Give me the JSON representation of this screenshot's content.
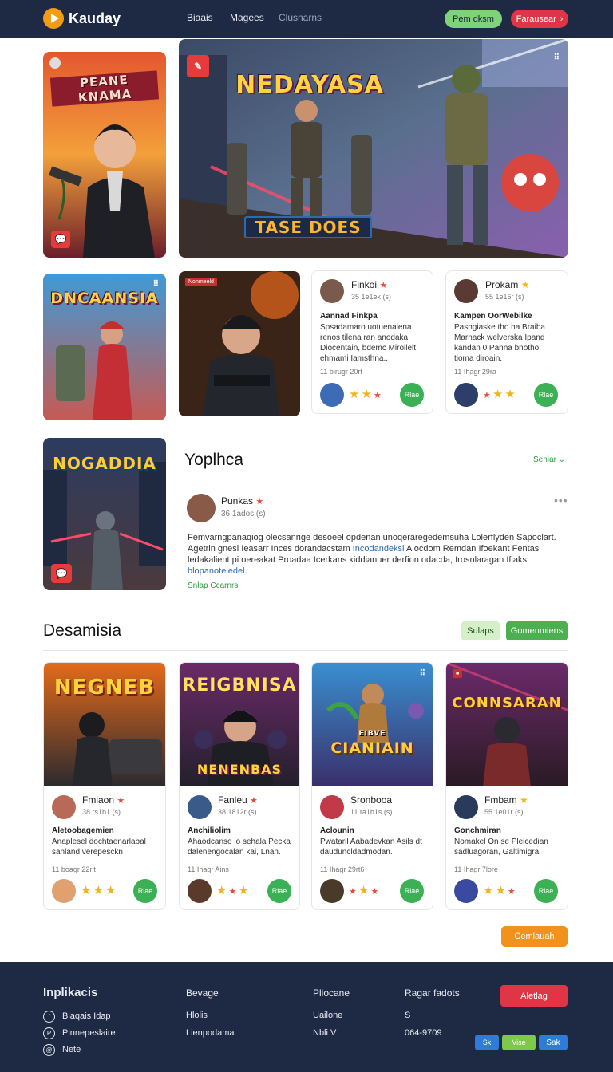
{
  "nav": {
    "brand": "Kauday",
    "links": [
      "Biaais",
      "Magees",
      "Clusnarns"
    ],
    "btn_green": "Pem dksm",
    "btn_red": "Farausear"
  },
  "hero": {
    "left_title": "PEANE KNAMA",
    "main_title": "NEDAYASA",
    "main_subtitle": "TASE DOES"
  },
  "row2": {
    "art1_title": "DNCAANSIA",
    "art2_tag": "Nonmeeld",
    "posts": [
      {
        "user": "Finkoi",
        "meta": "35 1e1ek (s)",
        "title": "Aannad Finkpa",
        "body": "Spsadamaro uotuenalena renos tilena ran anodaka Diocentain, bdemc Miroilelt, ehmami Iamsthna..",
        "date": "11 birugr 20rt",
        "btn": "Rlae"
      },
      {
        "user": "Prokam",
        "meta": "55 1e16r (s)",
        "title": "Kampen OorWebilke",
        "body": "Pashgiaske tho ha Braiba Marnack welverska Ipand kandan 0 Panna bnotho tioma diroain.",
        "date": "11 Ihagr 29ra",
        "btn": "Rlae"
      }
    ]
  },
  "feature": {
    "art_title": "NOGADDIA",
    "section_title": "Yoplhca",
    "see_all": "Seniar",
    "user": "Punkas",
    "meta": "36 1ados (s)",
    "body1_plain": "Femvarngpanaqiog olecsanrige desoeel opdenan unoqeraregedemsuha Lolerflyden Sapoclart. Agetrin gnesi Ieasarr Inces dorandacstam ",
    "body1_link": "Incodandeksi",
    "body2_plain": "Alocdom Remdan Ifoekant Fentas ledakalient pi oereakat Proadaa Icerkans kiddianuer derfion odacda, Irosnlaragan Ifiaks ",
    "body2_link": "blopanoteledel.",
    "more": "Snlap Ccarnrs"
  },
  "desamisia": {
    "title": "Desamisia",
    "pill1": "Sulaps",
    "pill2": "Gomenmiens",
    "cards": [
      {
        "art": "NEGNEB",
        "user": "Fmiaon",
        "meta": "38 rs1b1 (s)",
        "title": "Aletoobagemien",
        "body": "Anaplesel dochtaenarlabal sanland verepesckn",
        "date": "11 boagr 22rit",
        "btn": "Rlae"
      },
      {
        "art": "REIGBNISA",
        "art_sub": "NENENBAS",
        "user": "Fanleu",
        "meta": "38 1812r (s)",
        "title": "Anchiliolim",
        "body": "Ahaodcanso lo sehala Pecka dalenengocalan kai, Lnan.",
        "date": "11 Ihagr Ains",
        "btn": "Rlae"
      },
      {
        "art": "CIANIAIN",
        "art_sub": "EIBVE",
        "user": "Sronbooa",
        "meta": "11 ra1b1s (s)",
        "title": "Aclounin",
        "body": "Pwataril Aabadevkan Asils dt dauduncldadmodan.",
        "date": "11 Ihagr 29rt6",
        "btn": "Rlae"
      },
      {
        "art": "CONNSARAN",
        "user": "Fmbam",
        "meta": "55 1e01r (s)",
        "title": "Gonchmiran",
        "body": "Nomakel On se Pleicedian sadluagoran, Galtimigra.",
        "date": "11 Ihagr 7lore",
        "btn": "Rlae"
      }
    ],
    "continue_btn": "Cemlauah"
  },
  "footer": {
    "brand": "Inplikacis",
    "col1": [
      "Biaqais Idap",
      "Pinnepeslaire",
      "Nete"
    ],
    "col2_h": "Bevage",
    "col2": [
      "Hlolis",
      "Lienpodama"
    ],
    "col3_h": "Pliocane",
    "col3": [
      "Uailone",
      "Nbli V"
    ],
    "col4_h": "Ragar fadots",
    "col4": [
      "S",
      "064-9709"
    ],
    "btn": "Aletlag",
    "app1": "Sk",
    "app2": "Vise",
    "app3": "Sak"
  },
  "colors": {
    "navy": "#1e2a44",
    "green": "#3cb054",
    "red": "#e03545",
    "orange": "#f39c12"
  }
}
